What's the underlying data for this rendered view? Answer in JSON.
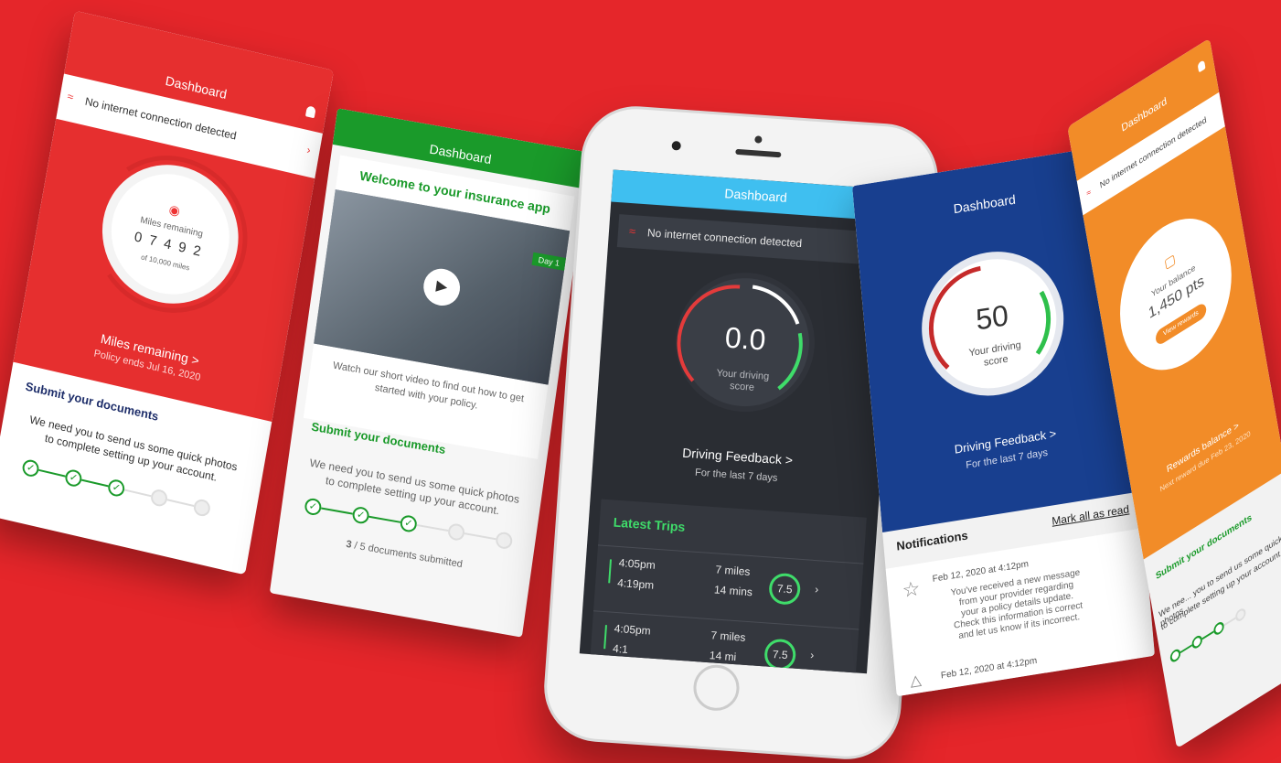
{
  "common": {
    "dashboard": "Dashboard",
    "no_internet": "No internet connection detected",
    "submit_docs": "Submit your documents",
    "docs_line1": "We need you to send us some quick photos",
    "docs_line2": "to complete setting up your account.",
    "driving_feedback": "Driving Feedback >",
    "last_7_days": "For the last 7 days",
    "your_driving": "Your driving",
    "score": "score"
  },
  "red": {
    "miles_remaining": "Miles remaining",
    "digits": "0 7 4 9 2",
    "of_miles": "of 10,000 miles",
    "link": "Miles remaining >",
    "policy_ends": "Policy ends Jul 16, 2020",
    "colors": {
      "bg": "#e62f2f"
    }
  },
  "green": {
    "welcome": "Welcome to your insurance app",
    "day_badge": "Day 1",
    "video_desc1": "Watch our short video to find out how to get",
    "video_desc2": "started with your policy.",
    "docs_count": "3",
    "docs_total": "/ 5 documents submitted",
    "colors": {
      "accent": "#1a9a2a"
    }
  },
  "center": {
    "score_value": "0.0",
    "latest_trips": "Latest Trips",
    "trips": [
      {
        "start": "4:05pm",
        "end": "4:19pm",
        "miles": "7 miles",
        "mins": "14 mins",
        "score": "7.5"
      },
      {
        "start": "4:05pm",
        "end": "4:1",
        "miles": "7 miles",
        "mins": "14 mi",
        "score": "7.5"
      }
    ],
    "colors": {
      "header": "#3fbff0",
      "screen": "#2a2d33"
    }
  },
  "blue": {
    "score_value": "50",
    "notifications": "Notifications",
    "mark_all": "Mark all as read",
    "notif_date_1": "Feb 12, 2020 at 4:12pm",
    "notif_body": [
      "You've received a new message",
      "from your provider regarding",
      "your a policy details update.",
      "Check this information is correct",
      "and let us know if its incorrect."
    ],
    "notif_date_2": "Feb 12, 2020 at 4:12pm",
    "colors": {
      "bg": "#183f8f"
    }
  },
  "orange": {
    "your_balance": "Your balance",
    "points": "1,450 pts",
    "view_rewards": "View rewards",
    "rewards_balance": "Rewards balance >",
    "next_reward": "Next reward due Feb 23, 2020",
    "submit_docs": "Submit your documents",
    "docs_line1": "We nee... you to send us some quick photos",
    "docs_line2": "to complete setting up your account.",
    "colors": {
      "bg": "#f28c28"
    }
  }
}
